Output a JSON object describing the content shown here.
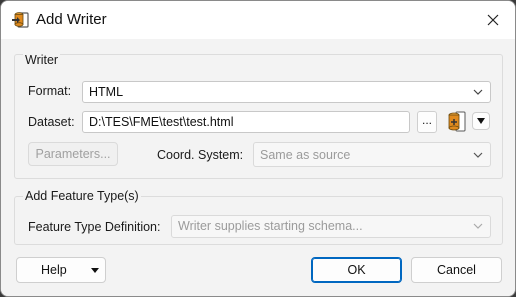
{
  "window": {
    "title": "Add Writer",
    "icon": "writer-icon",
    "close_icon": "close-icon"
  },
  "writer_group": {
    "title": "Writer",
    "format": {
      "label": "Format:",
      "value": "HTML"
    },
    "dataset": {
      "label": "Dataset:",
      "value": "D:\\TES\\FME\\test\\test.html",
      "browse_label": "..."
    },
    "parameters_button": "Parameters...",
    "coord_system": {
      "label": "Coord. System:",
      "value": "Same as source"
    }
  },
  "feature_type_group": {
    "title": "Add Feature Type(s)",
    "definition": {
      "label": "Feature Type Definition:",
      "value": "Writer supplies starting schema..."
    }
  },
  "footer": {
    "help_label": "Help",
    "ok_label": "OK",
    "cancel_label": "Cancel"
  },
  "colors": {
    "accent": "#0067c0",
    "icon_orange": "#e08a1e"
  }
}
